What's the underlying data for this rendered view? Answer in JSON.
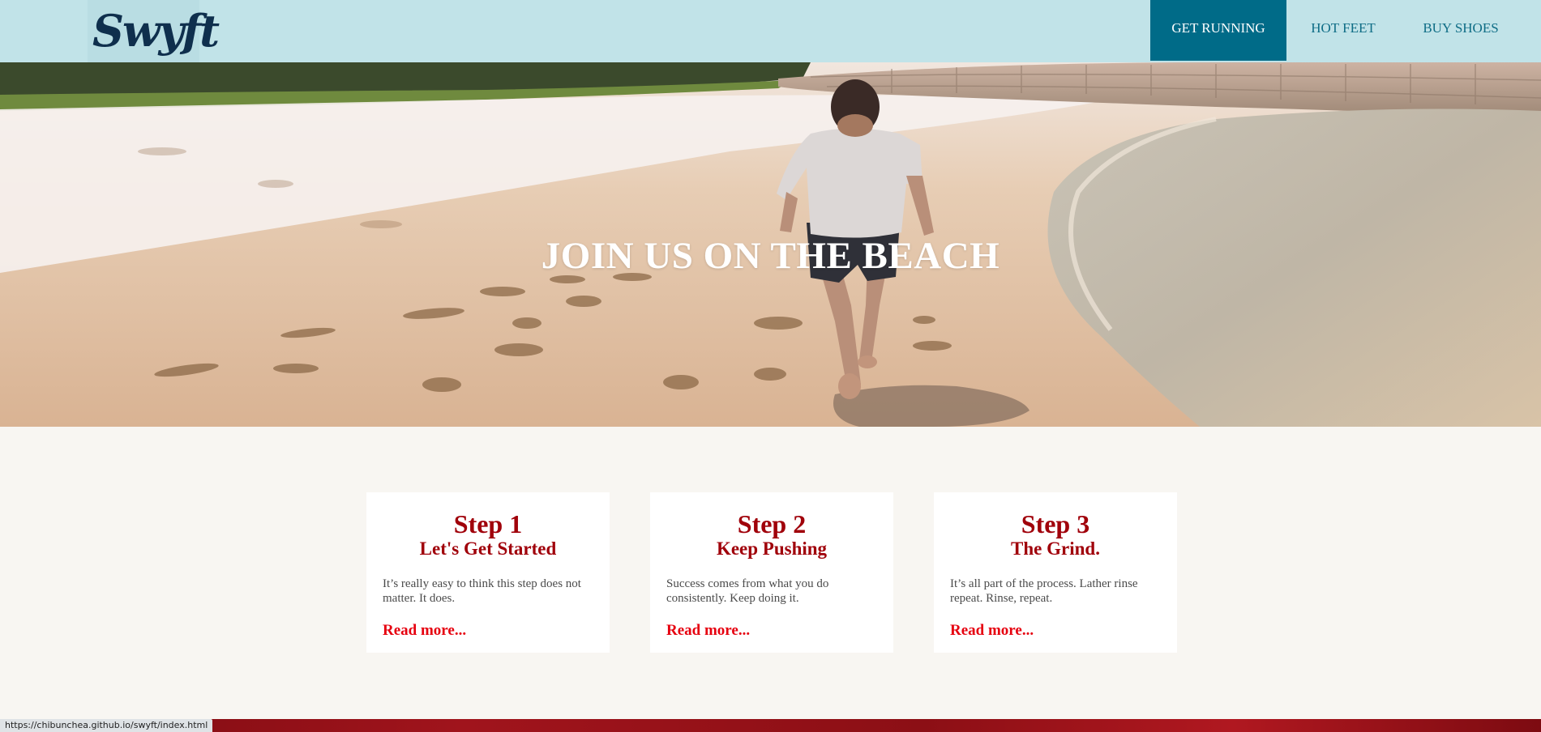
{
  "brand": {
    "logo_text": "Swyft"
  },
  "nav": {
    "items": [
      {
        "label": "GET RUNNING",
        "active": true
      },
      {
        "label": "HOT FEET",
        "active": false
      },
      {
        "label": "BUY SHOES",
        "active": false
      }
    ]
  },
  "hero": {
    "title": "JOIN US ON THE BEACH"
  },
  "cards": [
    {
      "step": "Step 1",
      "subtitle": "Let's Get Started",
      "text": "It’s really easy to think this step does not matter. It does.",
      "link": "Read more..."
    },
    {
      "step": "Step 2",
      "subtitle": "Keep Pushing",
      "text": "Success comes from what you do consistently. Keep doing it.",
      "link": "Read more..."
    },
    {
      "step": "Step 3",
      "subtitle": "The Grind.",
      "text": "It’s all part of the process. Lather rinse repeat. Rinse, repeat.",
      "link": "Read more..."
    }
  ],
  "status_bar": {
    "url": "https://chibunchea.github.io/swyft/index.html"
  },
  "colors": {
    "header_bg": "#c1e3e8",
    "nav_active_bg": "#006b88",
    "nav_text": "#0f6d86",
    "card_heading": "#a0000a",
    "card_link": "#e6000f",
    "page_bg": "#f8f6f2"
  }
}
